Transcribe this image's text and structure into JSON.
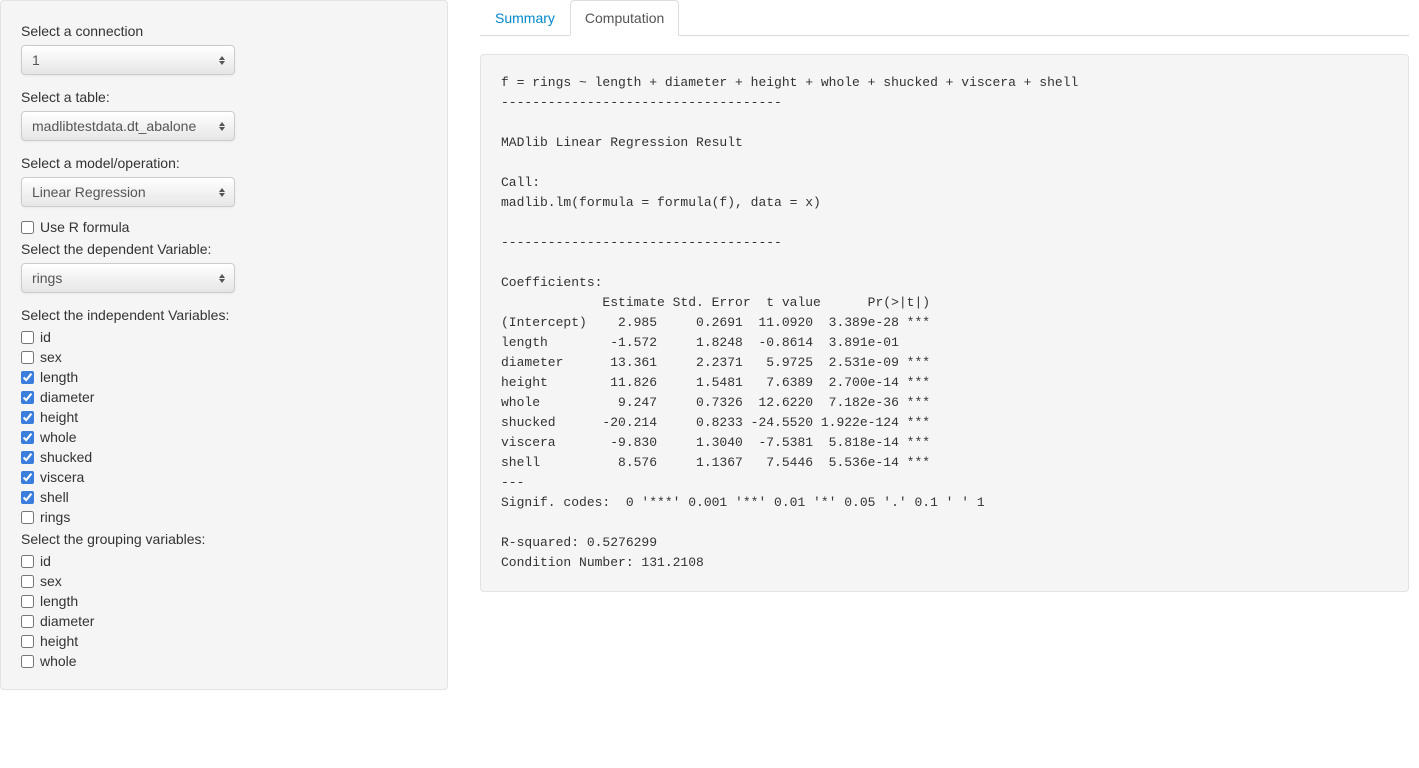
{
  "sidebar": {
    "connection": {
      "label": "Select a connection",
      "value": "1"
    },
    "table": {
      "label": "Select a table:",
      "value": "madlibtestdata.dt_abalone"
    },
    "model": {
      "label": "Select a model/operation:",
      "value": "Linear Regression"
    },
    "use_r_formula": {
      "label": "Use R formula",
      "checked": false
    },
    "dependent": {
      "label": "Select the dependent Variable:",
      "value": "rings"
    },
    "independent_label": "Select the independent Variables:",
    "independent_vars": [
      {
        "name": "id",
        "checked": false
      },
      {
        "name": "sex",
        "checked": false
      },
      {
        "name": "length",
        "checked": true
      },
      {
        "name": "diameter",
        "checked": true
      },
      {
        "name": "height",
        "checked": true
      },
      {
        "name": "whole",
        "checked": true
      },
      {
        "name": "shucked",
        "checked": true
      },
      {
        "name": "viscera",
        "checked": true
      },
      {
        "name": "shell",
        "checked": true
      },
      {
        "name": "rings",
        "checked": false
      }
    ],
    "grouping_label": "Select the grouping variables:",
    "grouping_vars": [
      {
        "name": "id",
        "checked": false
      },
      {
        "name": "sex",
        "checked": false
      },
      {
        "name": "length",
        "checked": false
      },
      {
        "name": "diameter",
        "checked": false
      },
      {
        "name": "height",
        "checked": false
      },
      {
        "name": "whole",
        "checked": false
      }
    ]
  },
  "tabs": {
    "summary": "Summary",
    "computation": "Computation"
  },
  "output": "f = rings ~ length + diameter + height + whole + shucked + viscera + shell\n------------------------------------\n\nMADlib Linear Regression Result\n\nCall:\nmadlib.lm(formula = formula(f), data = x)\n\n------------------------------------\n\nCoefficients:\n             Estimate Std. Error  t value      Pr(>|t|)\n(Intercept)    2.985     0.2691  11.0920  3.389e-28 ***\nlength        -1.572     1.8248  -0.8614  3.891e-01\ndiameter      13.361     2.2371   5.9725  2.531e-09 ***\nheight        11.826     1.5481   7.6389  2.700e-14 ***\nwhole          9.247     0.7326  12.6220  7.182e-36 ***\nshucked      -20.214     0.8233 -24.5520 1.922e-124 ***\nviscera       -9.830     1.3040  -7.5381  5.818e-14 ***\nshell          8.576     1.1367   7.5446  5.536e-14 ***\n---\nSignif. codes:  0 '***' 0.001 '**' 0.01 '*' 0.05 '.' 0.1 ' ' 1\n\nR-squared: 0.5276299\nCondition Number: 131.2108",
  "chart_data": {
    "type": "table",
    "title": "MADlib Linear Regression Result",
    "formula": "rings ~ length + diameter + height + whole + shucked + viscera + shell",
    "columns": [
      "Term",
      "Estimate",
      "Std. Error",
      "t value",
      "Pr(>|t|)",
      "Signif"
    ],
    "rows": [
      [
        "(Intercept)",
        2.985,
        0.2691,
        11.092,
        3.389e-28,
        "***"
      ],
      [
        "length",
        -1.572,
        1.8248,
        -0.8614,
        0.3891,
        ""
      ],
      [
        "diameter",
        13.361,
        2.2371,
        5.9725,
        2.531e-09,
        "***"
      ],
      [
        "height",
        11.826,
        1.5481,
        7.6389,
        2.7e-14,
        "***"
      ],
      [
        "whole",
        9.247,
        0.7326,
        12.622,
        7.182e-36,
        "***"
      ],
      [
        "shucked",
        -20.214,
        0.8233,
        -24.552,
        1.922e-124,
        "***"
      ],
      [
        "viscera",
        -9.83,
        1.304,
        -7.5381,
        5.818e-14,
        "***"
      ],
      [
        "shell",
        8.576,
        1.1367,
        7.5446,
        5.536e-14,
        "***"
      ]
    ],
    "r_squared": 0.5276299,
    "condition_number": 131.2108,
    "signif_codes": "0 '***' 0.001 '**' 0.01 '*' 0.05 '.' 0.1 ' ' 1"
  }
}
